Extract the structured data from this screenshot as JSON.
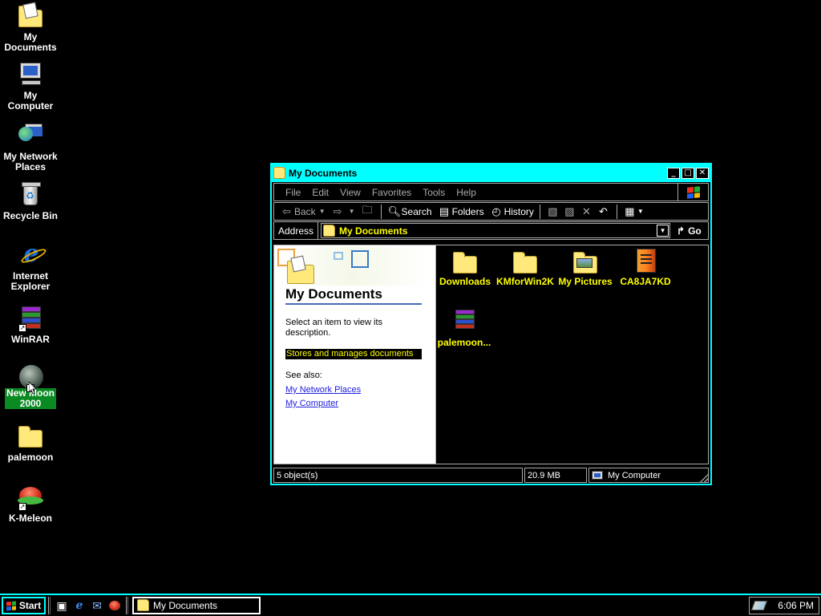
{
  "desktop": {
    "icons": [
      {
        "label_line1": "My",
        "label_line2": "Documents"
      },
      {
        "label_line1": "My",
        "label_line2": "Computer"
      },
      {
        "label_line1": "My Network",
        "label_line2": "Places"
      },
      {
        "label_line1": "Recycle Bin",
        "label_line2": ""
      },
      {
        "label_line1": "Internet",
        "label_line2": "Explorer"
      },
      {
        "label_line1": "WinRAR",
        "label_line2": ""
      },
      {
        "label_line1": "New Moon",
        "label_line2": "2000"
      },
      {
        "label_line1": "palemoon",
        "label_line2": ""
      },
      {
        "label_line1": "K-Meleon",
        "label_line2": ""
      }
    ]
  },
  "window": {
    "title": "My Documents",
    "controls": {
      "minimize": "_",
      "maximize": "□",
      "close": "✕"
    },
    "menu": [
      "File",
      "Edit",
      "View",
      "Favorites",
      "Tools",
      "Help"
    ],
    "toolbar": {
      "back": "Back",
      "search": "Search",
      "folders": "Folders",
      "history": "History"
    },
    "address": {
      "label": "Address",
      "value": "My Documents",
      "go": "Go"
    },
    "left_pane": {
      "title": "My Documents",
      "description": "Select an item to view its description.",
      "highlight": "Stores and manages documents",
      "see_also": "See also:",
      "links": [
        "My Network Places",
        "My Computer"
      ]
    },
    "items": [
      {
        "name": "Downloads",
        "icon": "folder-icon"
      },
      {
        "name": "KMforWin2K",
        "icon": "folder-icon"
      },
      {
        "name": "My Pictures",
        "icon": "pictures-folder-icon"
      },
      {
        "name": "CA8JA7KD",
        "icon": "book-icon"
      },
      {
        "name": "palemoon...",
        "icon": "rar-archive-icon"
      }
    ],
    "status": {
      "objects": "5 object(s)",
      "size": "20.9 MB",
      "zone": "My Computer"
    }
  },
  "taskbar": {
    "start": "Start",
    "task": "My Documents",
    "clock": "6:06 PM"
  },
  "colors": {
    "accent": "#00ffff",
    "label_yellow": "#ffff00",
    "selection_green": "#0a8a22"
  }
}
